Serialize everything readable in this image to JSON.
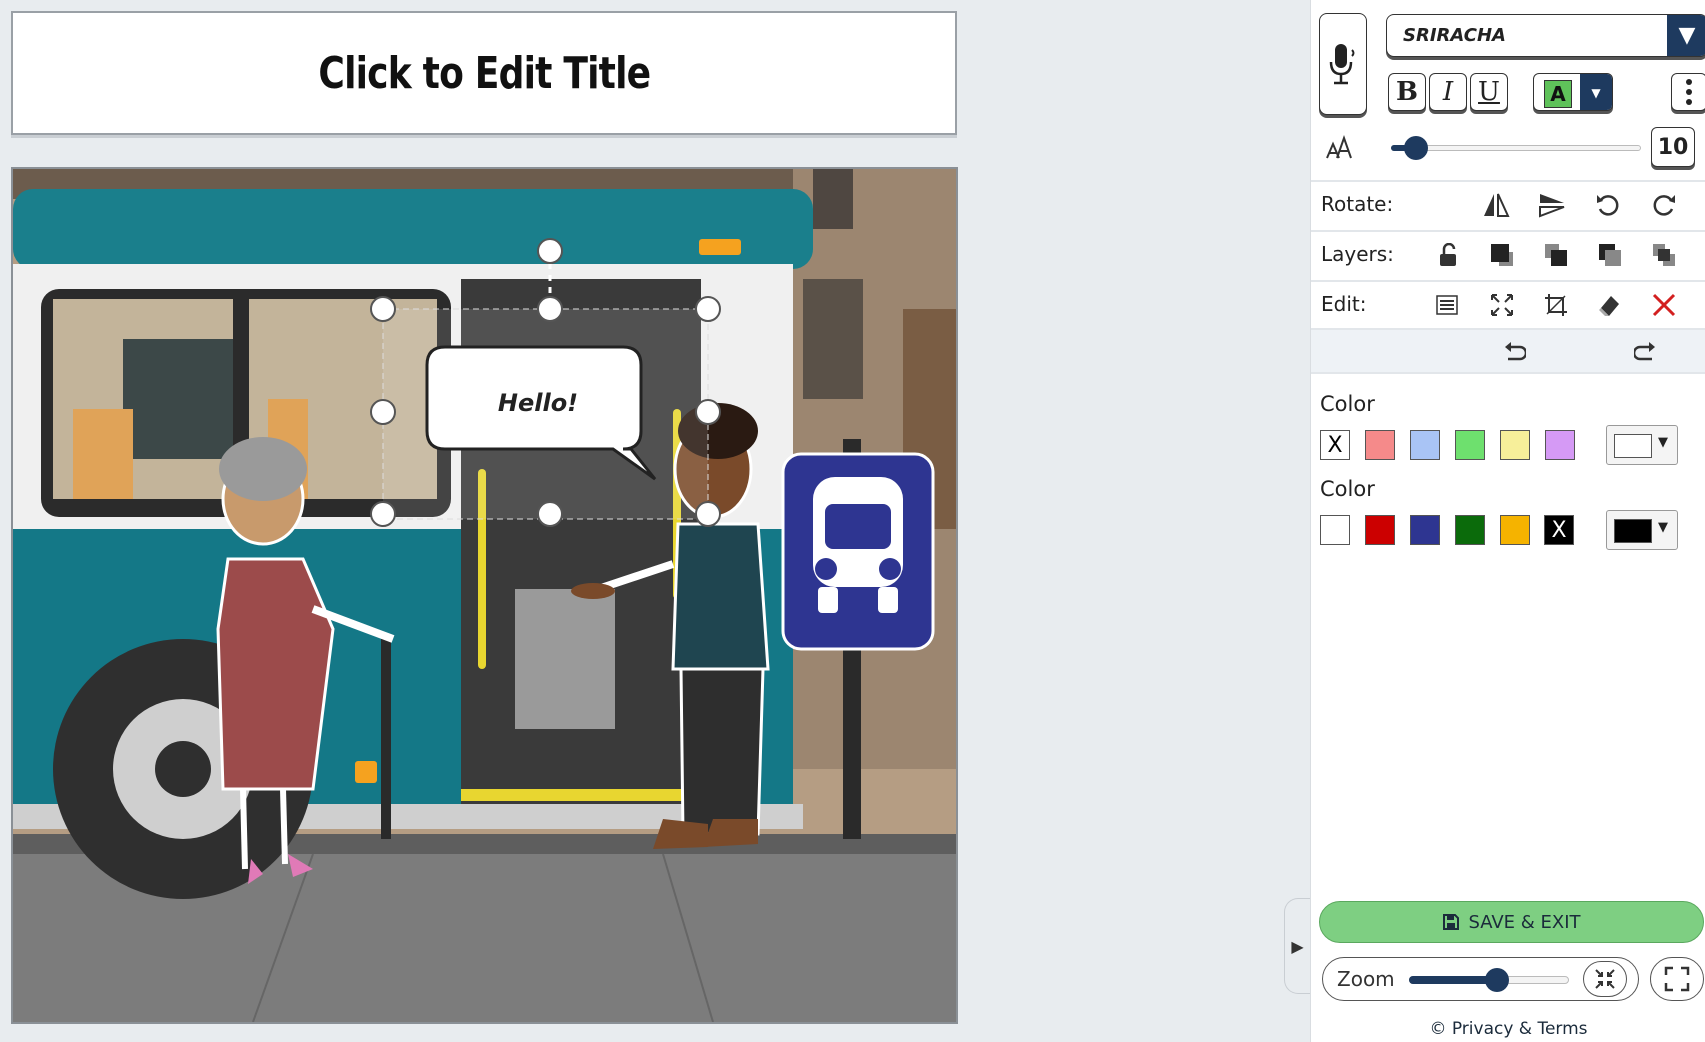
{
  "title": {
    "text": "Click to Edit Title"
  },
  "scene": {
    "speech_bubble_text": "Hello!"
  },
  "text_tools": {
    "font_name": "SRIRACHA",
    "bold_label": "B",
    "italic_label": "I",
    "underline_label": "U",
    "text_color_label": "A",
    "font_size": "10",
    "font_size_fraction": 0.1
  },
  "tool_rows": {
    "rotate_label": "Rotate:",
    "layers_label": "Layers:",
    "edit_label": "Edit:"
  },
  "colors": {
    "fill": {
      "label": "Color",
      "none_label": "X",
      "swatches": [
        "#f58a8a",
        "#a9c4f5",
        "#6ee06e",
        "#f7ef9a",
        "#d59af5"
      ],
      "selected": "#ffffff"
    },
    "outline": {
      "label": "Color",
      "none_label": "X",
      "swatches": [
        "#ffffff",
        "#cc0000",
        "#2e3591",
        "#0b6b0b",
        "#f5b300"
      ],
      "selected": "#000000"
    }
  },
  "footer": {
    "save_label": "SAVE & EXIT",
    "zoom_label": "Zoom",
    "zoom_fraction": 0.55,
    "privacy_label": "© Privacy & Terms"
  },
  "icons": {
    "mic": "microphone-icon",
    "flip_h": "flip-horizontal-icon",
    "flip_v": "flip-vertical-icon",
    "rotate_ccw": "rotate-left-icon",
    "rotate_cw": "rotate-right-icon",
    "unlock": "unlock-icon",
    "bring_front": "bring-to-front-icon",
    "bring_forward": "bring-forward-icon",
    "send_backward": "send-backward-icon",
    "send_back": "send-to-back-icon",
    "details": "details-icon",
    "resize": "resize-icon",
    "crop": "crop-icon",
    "eraser": "eraser-icon",
    "delete": "delete-icon",
    "undo": "undo-icon",
    "redo": "redo-icon",
    "save": "save-icon",
    "fit": "fit-screen-icon",
    "fullscreen": "fullscreen-icon"
  }
}
